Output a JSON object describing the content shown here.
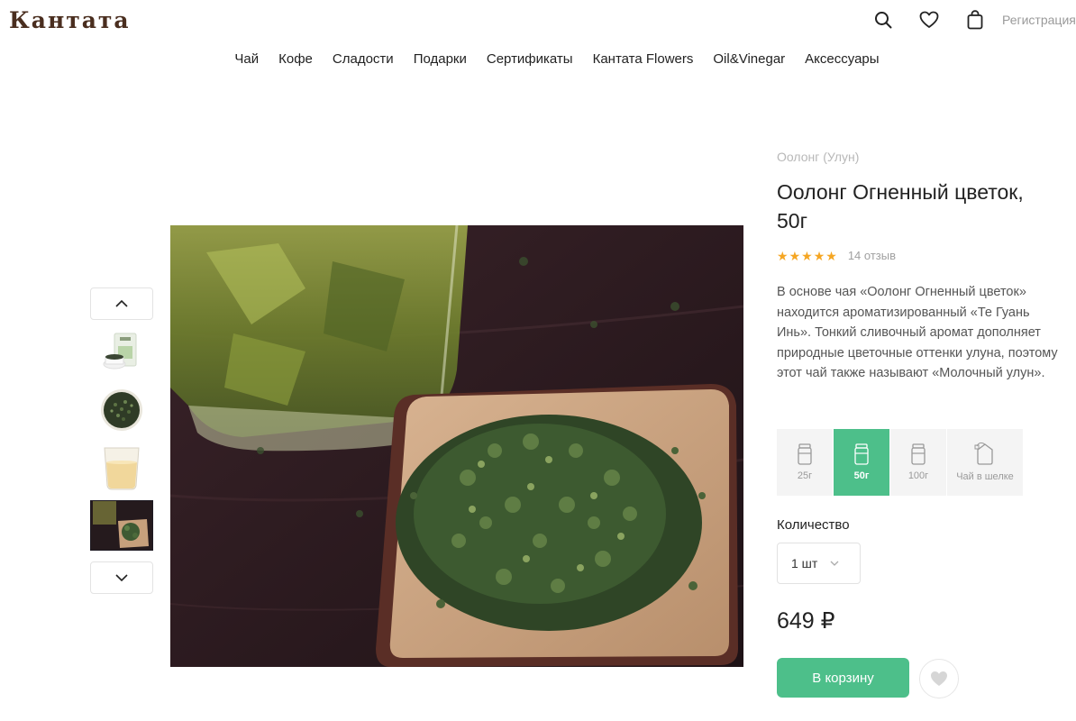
{
  "header": {
    "logo": "Кантата",
    "register_label": "Регистрация",
    "icons": [
      "search-icon",
      "heart-icon",
      "bag-icon"
    ]
  },
  "nav": {
    "items": [
      "Чай",
      "Кофе",
      "Сладости",
      "Подарки",
      "Сертификаты",
      "Кантата Flowers",
      "Oil&Vinegar",
      "Аксессуары"
    ]
  },
  "gallery": {
    "thumbnails": [
      "tea-package-thumbnail",
      "tea-leaves-bowl-thumbnail",
      "tea-glass-thumbnail",
      "tea-coaster-thumbnail"
    ],
    "active_index": 3
  },
  "product": {
    "category": "Оолонг (Улун)",
    "title": "Оолонг Огненный цветок, 50г",
    "rating": 5,
    "reviews": "14 отзыв",
    "description": "В основе чая «Оолонг Огненный цветок» находится ароматизированный «Те Гуань Инь». Тонкий сливочный аромат дополняет природные цветочные оттенки улуна, поэтому этот чай также называют «Молочный улун».",
    "variants": [
      {
        "label": "25г",
        "icon": "jar-icon"
      },
      {
        "label": "50г",
        "icon": "jar-icon"
      },
      {
        "label": "100г",
        "icon": "jar-icon"
      },
      {
        "label": "Чай в шелке",
        "icon": "teabag-icon"
      }
    ],
    "selected_variant_index": 1,
    "quantity_label": "Количество",
    "quantity_value": "1 шт",
    "price": "649 ₽",
    "add_to_cart_label": "В корзину"
  },
  "colors": {
    "accent": "#4dbf8a",
    "star": "#f5a623",
    "logo": "#4a2e1f"
  }
}
